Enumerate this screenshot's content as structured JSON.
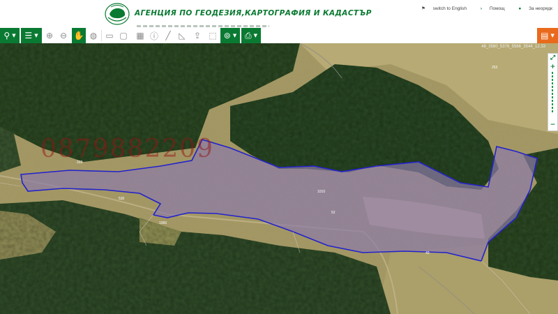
{
  "header": {
    "agency_name": "АГЕНЦИЯ ПО ГЕОДЕЗИЯ,КАРТОГРАФИЯ И КАДАСТЪР",
    "links": [
      "switch to English",
      "Помощ",
      "За неорядк"
    ]
  },
  "toolbar": {
    "icons": [
      "search-icon",
      "layers-icon",
      "zoom-in-icon",
      "zoom-out-icon",
      "pan-hand-icon",
      "globe-icon",
      "rectangle-select-icon",
      "screen-icon",
      "table-icon",
      "info-icon",
      "measure-line-icon",
      "measure-area-icon",
      "upload-icon",
      "select-icon",
      "location-icon",
      "print-icon",
      "menu-icon"
    ],
    "accent": "#0a7a32",
    "orange": "#e96a1c"
  },
  "map": {
    "watermark": "0879882209",
    "coords_text": "48_3560_5376_5566_3544_12.33",
    "parcel_labels": [
      "253",
      "530",
      "1066",
      "1010",
      "52",
      "49",
      "203"
    ],
    "outline_color": "#2222cc"
  }
}
